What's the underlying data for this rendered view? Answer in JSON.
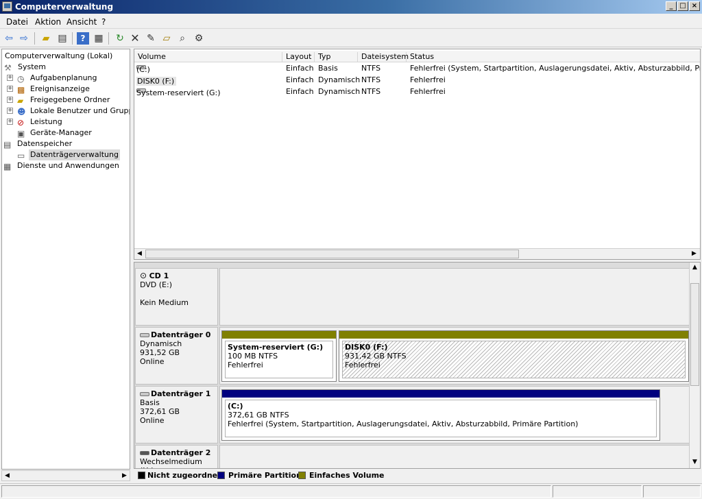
{
  "window": {
    "title": "Computerverwaltung",
    "buttons": [
      "_",
      "□",
      "×"
    ]
  },
  "menu": [
    "Datei",
    "Aktion",
    "Ansicht",
    "?"
  ],
  "tree": {
    "root": "Computerverwaltung (Lokal)",
    "system": "System",
    "items": [
      "Aufgabenplanung",
      "Ereignisanzeige",
      "Freigegebene Ordner",
      "Lokale Benutzer und Gruppen",
      "Leistung",
      "Geräte-Manager"
    ],
    "storage": "Datenspeicher",
    "disk_mgmt": "Datenträgerverwaltung",
    "services": "Dienste und Anwendungen"
  },
  "volumes": {
    "columns": [
      "Volume",
      "Layout",
      "Typ",
      "Dateisystem",
      "Status"
    ],
    "rows": [
      [
        "(C:)",
        "Einfach",
        "Basis",
        "NTFS",
        "Fehlerfrei (System, Startpartition, Auslagerungsdatei, Aktiv, Absturzabbild, Primäre Partition)"
      ],
      [
        "DISK0 (F:)",
        "Einfach",
        "Dynamisch",
        "NTFS",
        "Fehlerfrei"
      ],
      [
        "System-reserviert (G:)",
        "Einfach",
        "Dynamisch",
        "NTFS",
        "Fehlerfrei"
      ]
    ]
  },
  "disks": {
    "cd1": {
      "name": "CD 1",
      "type": "DVD (E:)",
      "media": "Kein Medium"
    },
    "d0": {
      "name": "Datenträger 0",
      "type": "Dynamisch",
      "size": "931,52 GB",
      "state": "Online",
      "p1": {
        "name": "System-reserviert  (G:)",
        "size": "100 MB NTFS",
        "status": "Fehlerfrei"
      },
      "p2": {
        "name": "DISK0  (F:)",
        "size": "931,42 GB NTFS",
        "status": "Fehlerfrei"
      }
    },
    "d1": {
      "name": "Datenträger 1",
      "type": "Basis",
      "size": "372,61 GB",
      "state": "Online",
      "p1": {
        "name": "(C:)",
        "size": "372,61 GB NTFS",
        "status": "Fehlerfrei (System, Startpartition, Auslagerungsdatei, Aktiv, Absturzabbild, Primäre Partition)"
      }
    },
    "d2": {
      "name": "Datenträger 2",
      "type": "Wechselmedium (H:)"
    }
  },
  "legend": [
    {
      "label": "Nicht zugeordnet",
      "color": "#000000"
    },
    {
      "label": "Primäre Partition",
      "color": "#00007f"
    },
    {
      "label": "Einfaches Volume",
      "color": "#808000"
    }
  ],
  "icons": [
    "back-arrow-icon",
    "forward-arrow-icon",
    "up-folder-icon",
    "show-hide-tree-icon",
    "help-icon",
    "properties-icon",
    "refresh-icon",
    "delete-icon",
    "edit-icon",
    "open-folder-icon",
    "search-icon",
    "settings-icon"
  ]
}
